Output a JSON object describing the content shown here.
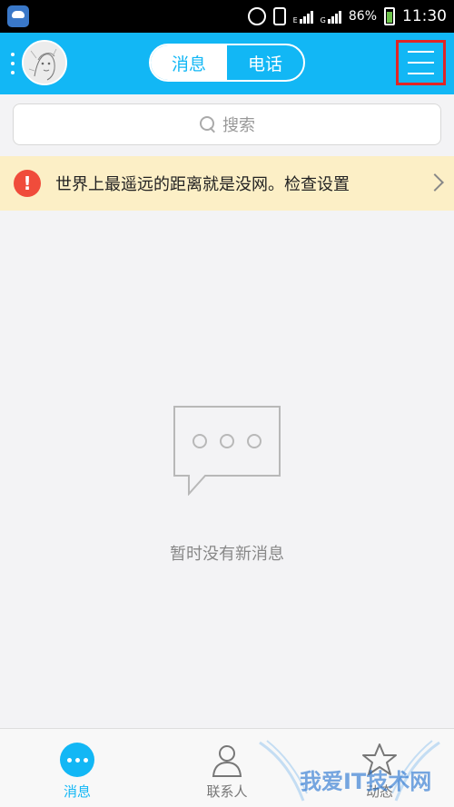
{
  "status_bar": {
    "network_type_1": "E",
    "network_type_2": "G",
    "battery": "86%",
    "time": "11:30"
  },
  "header": {
    "tabs": [
      {
        "label": "消息",
        "active": true
      },
      {
        "label": "电话",
        "active": false
      }
    ]
  },
  "search": {
    "placeholder": "搜索"
  },
  "notice": {
    "text": "世界上最遥远的距离就是没网。检查设置"
  },
  "empty_state": {
    "text": "暂时没有新消息"
  },
  "tab_bar": {
    "items": [
      {
        "label": "消息",
        "icon": "chat-bubble-icon",
        "active": true
      },
      {
        "label": "联系人",
        "icon": "contacts-icon",
        "active": false
      },
      {
        "label": "动态",
        "icon": "star-icon",
        "active": false
      }
    ]
  },
  "watermark": {
    "text": "我爱IT技术网"
  },
  "colors": {
    "brand": "#12b7f5",
    "notice_bg": "#fcefc6",
    "warning": "#f04c3b",
    "highlight_box": "#e02525"
  }
}
